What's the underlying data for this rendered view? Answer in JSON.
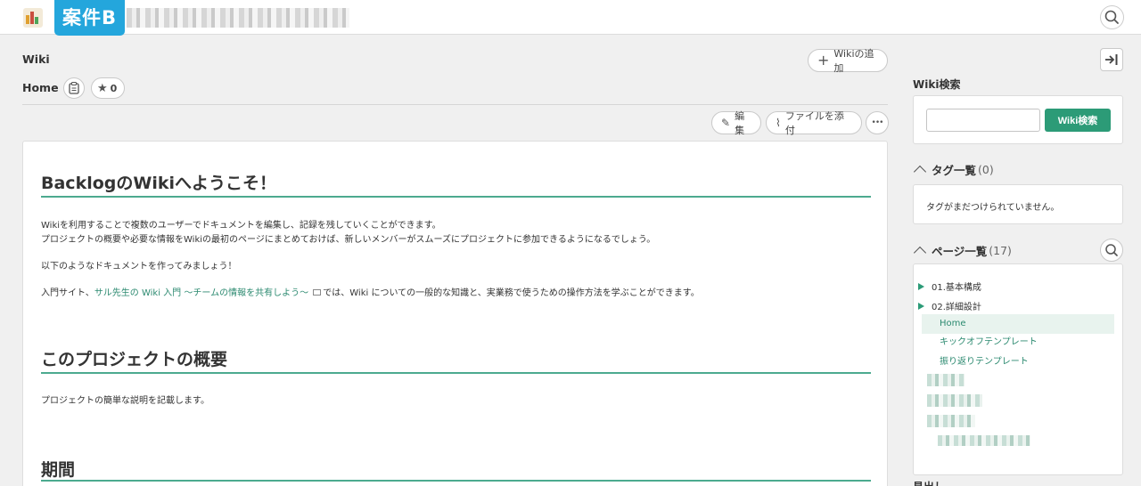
{
  "header": {
    "project_badge": "案件B"
  },
  "wiki": {
    "section_title": "Wiki",
    "add_button": "Wikiの追加",
    "page_name": "Home",
    "star_count": "0",
    "edit_button": "編集",
    "attach_button": "ファイルを添付",
    "more_button": "•••"
  },
  "document": {
    "heading1": "BacklogのWikiへようこそ！",
    "intro_line1": "Wikiを利用することで複数のユーザーでドキュメントを編集し、記録を残していくことができます。",
    "intro_line2": "プロジェクトの概要や必要な情報をWikiの最初のページにまとめておけば、新しいメンバーがスムーズにプロジェクトに参加できるようになるでしょう。",
    "intro_line3": "以下のようなドキュメントを作ってみましょう！",
    "link_prefix": "入門サイト、",
    "link_text": "サル先生の Wiki 入門 〜チームの情報を共有しよう〜",
    "link_suffix": "では、Wiki についての一般的な知識と、実業務で使うための操作方法を学ぶことができます。",
    "heading2": "このプロジェクトの概要",
    "overview_text": "プロジェクトの簡単な説明を記載します。",
    "heading3": "期間"
  },
  "sidebar": {
    "search_title": "Wiki検索",
    "search_value": "",
    "search_button": "Wiki検索",
    "tags_title": "タグ一覧",
    "tags_count": "(0)",
    "tags_empty": "タグがまだつけられていません。",
    "pages_title": "ページ一覧",
    "pages_count": "(17)",
    "pages": [
      {
        "label": "01.基本構成"
      },
      {
        "label": "02.詳細設計"
      },
      {
        "label": "Home"
      },
      {
        "label": "キックオフテンプレート"
      },
      {
        "label": "振り返りテンプレート"
      }
    ],
    "headings_title": "見出し"
  },
  "colors": {
    "accent": "#2c9b77",
    "badge": "#24a6dc",
    "heading_underline": "#4caa8f",
    "selected_row": "#e8f3ee"
  }
}
